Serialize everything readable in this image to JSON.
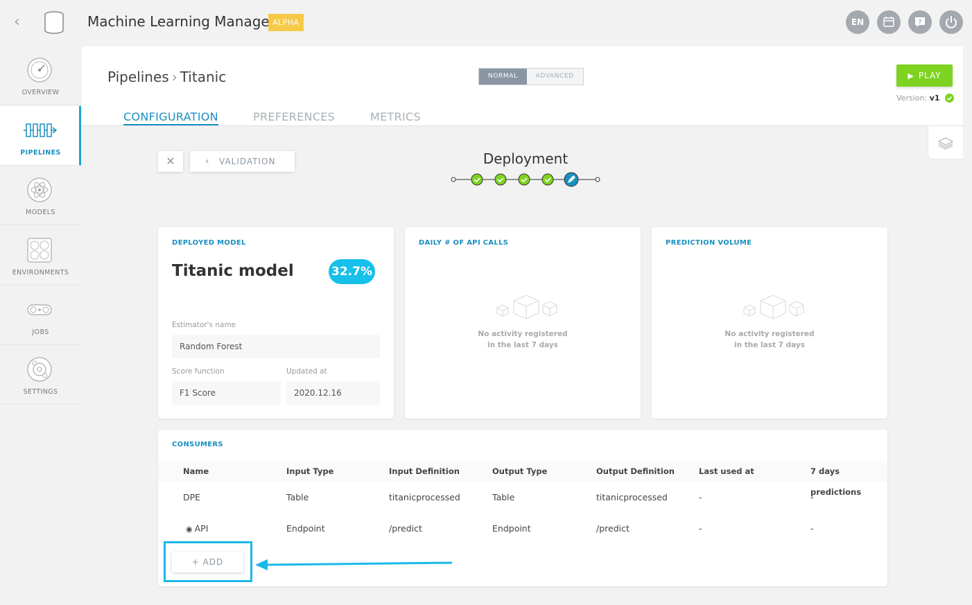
{
  "app": {
    "title": "Machine Learning Manager",
    "badge": "ALPHA",
    "lang": "EN"
  },
  "sidebar": {
    "items": [
      {
        "label": "OVERVIEW",
        "icon": "gauge-icon"
      },
      {
        "label": "PIPELINES",
        "icon": "pipeline-icon"
      },
      {
        "label": "MODELS",
        "icon": "atom-icon"
      },
      {
        "label": "ENVIRONMENTS",
        "icon": "environments-icon"
      },
      {
        "label": "JOBS",
        "icon": "conveyor-icon"
      },
      {
        "label": "SETTINGS",
        "icon": "gear-icon"
      }
    ],
    "active": "PIPELINES"
  },
  "header": {
    "breadcrumb_root": "Pipelines",
    "breadcrumb_current": "Titanic",
    "mode_normal": "NORMAL",
    "mode_advanced": "ADVANCED",
    "play_label": "PLAY",
    "version_label": "Version:",
    "version_value": "v1"
  },
  "tabs": {
    "configuration": "CONFIGURATION",
    "preferences": "PREFERENCES",
    "metrics": "METRICS",
    "active": "CONFIGURATION"
  },
  "wizard": {
    "validation_label": "VALIDATION",
    "step_title": "Deployment",
    "steps_completed": 4,
    "current_step": 5
  },
  "deployed_model": {
    "card_title": "DEPLOYED MODEL",
    "name": "Titanic model",
    "score": "32.7%",
    "estimator_label": "Estimator's name",
    "estimator_value": "Random Forest",
    "score_fn_label": "Score function",
    "score_fn_value": "F1 Score",
    "updated_label": "Updated at",
    "updated_value": "2020.12.16"
  },
  "api_calls": {
    "card_title": "DAILY # OF API CALLS",
    "empty_line1": "No activity registered",
    "empty_line2": "in the last 7 days"
  },
  "prediction_volume": {
    "card_title": "PREDICTION VOLUME",
    "empty_line1": "No activity registered",
    "empty_line2": "in the last 7 days"
  },
  "consumers": {
    "card_title": "CONSUMERS",
    "columns": [
      "Name",
      "Input Type",
      "Input Definition",
      "Output Type",
      "Output Definition",
      "Last used at",
      "7 days predictions"
    ],
    "rows": [
      [
        "DPE",
        "Table",
        "titanicprocessed",
        "Table",
        "titanicprocessed",
        "-",
        "-"
      ],
      [
        "API",
        "Endpoint",
        "/predict",
        "Endpoint",
        "/predict",
        "-",
        "-"
      ]
    ],
    "add_label": "+ ADD"
  },
  "colors": {
    "accent": "#1a8fc0",
    "play": "#7ed321",
    "badge": "#f7c948",
    "score": "#17c0eb",
    "highlight": "#1ab8e8"
  }
}
